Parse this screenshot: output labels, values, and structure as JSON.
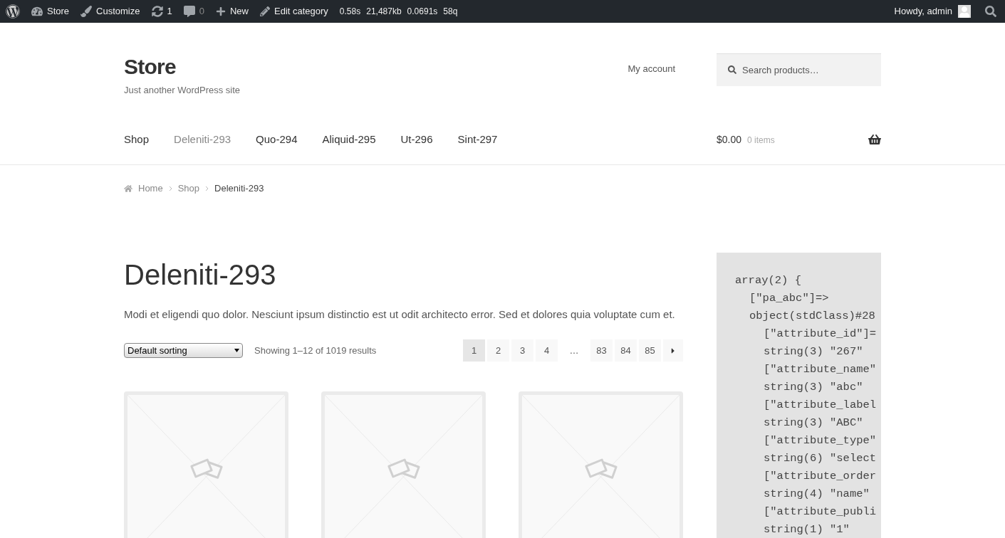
{
  "admin_bar": {
    "items": [
      {
        "kind": "wp"
      },
      {
        "kind": "dashboard",
        "label": "Store"
      },
      {
        "kind": "brush",
        "label": "Customize"
      },
      {
        "kind": "updates",
        "label": "1"
      },
      {
        "kind": "comments",
        "label": "0"
      },
      {
        "kind": "plus",
        "label": "New"
      },
      {
        "kind": "pencil",
        "label": "Edit category"
      }
    ],
    "stats": [
      "0.58s",
      "21,487kb",
      "0.0691s",
      "58q"
    ],
    "greeting": "Howdy, admin"
  },
  "header": {
    "site_title": "Store",
    "tagline": "Just another WordPress site",
    "account_link": "My account",
    "search": {
      "placeholder": "Search products…"
    }
  },
  "nav": [
    {
      "label": "Shop",
      "selected": false
    },
    {
      "label": "Deleniti-293",
      "selected": true
    },
    {
      "label": "Quo-294",
      "selected": false
    },
    {
      "label": "Aliquid-295",
      "selected": false
    },
    {
      "label": "Ut-296",
      "selected": false
    },
    {
      "label": "Sint-297",
      "selected": false
    }
  ],
  "cart": {
    "amount": "$0.00",
    "count": "0 items"
  },
  "breadcrumb": [
    "Home",
    "Shop",
    "Deleniti-293"
  ],
  "page_title": "Deleniti-293",
  "description": "Modi et eligendi quo dolor. Nesciunt ipsum distinctio est ut odit architecto error. Sed et dolores quia voluptate cum et.",
  "sorting": {
    "value": "Default sorting"
  },
  "result_count": "Showing 1–12 of 1019 results",
  "pagination": [
    {
      "kind": "page",
      "label": "1",
      "selected": true
    },
    {
      "kind": "page",
      "label": "2",
      "selected": false
    },
    {
      "kind": "page",
      "label": "3",
      "selected": false
    },
    {
      "kind": "page",
      "label": "4",
      "selected": false
    },
    {
      "kind": "dots",
      "label": "…"
    },
    {
      "kind": "page",
      "label": "83",
      "selected": false
    },
    {
      "kind": "page",
      "label": "84",
      "selected": false
    },
    {
      "kind": "page",
      "label": "85",
      "selected": false
    }
  ],
  "code_lines": [
    {
      "text": "array(2) {",
      "children": [
        {
          "text": "[\"pa_abc\"]=>"
        },
        {
          "text": "object(stdClass)#28",
          "children": [
            {
              "text": "[\"attribute_id\"]="
            },
            {
              "text": "string(3) \"267\""
            },
            {
              "text": "[\"attribute_name\""
            },
            {
              "text": "string(3) \"abc\""
            },
            {
              "text": "[\"attribute_label"
            },
            {
              "text": "string(3) \"ABC\""
            },
            {
              "text": "[\"attribute_type\""
            },
            {
              "text": "string(6) \"select"
            },
            {
              "text": "[\"attribute_order"
            },
            {
              "text": "string(4) \"name\""
            },
            {
              "text": "[\"attribute_publi"
            },
            {
              "text": "string(1) \"1\""
            }
          ]
        }
      ]
    }
  ]
}
